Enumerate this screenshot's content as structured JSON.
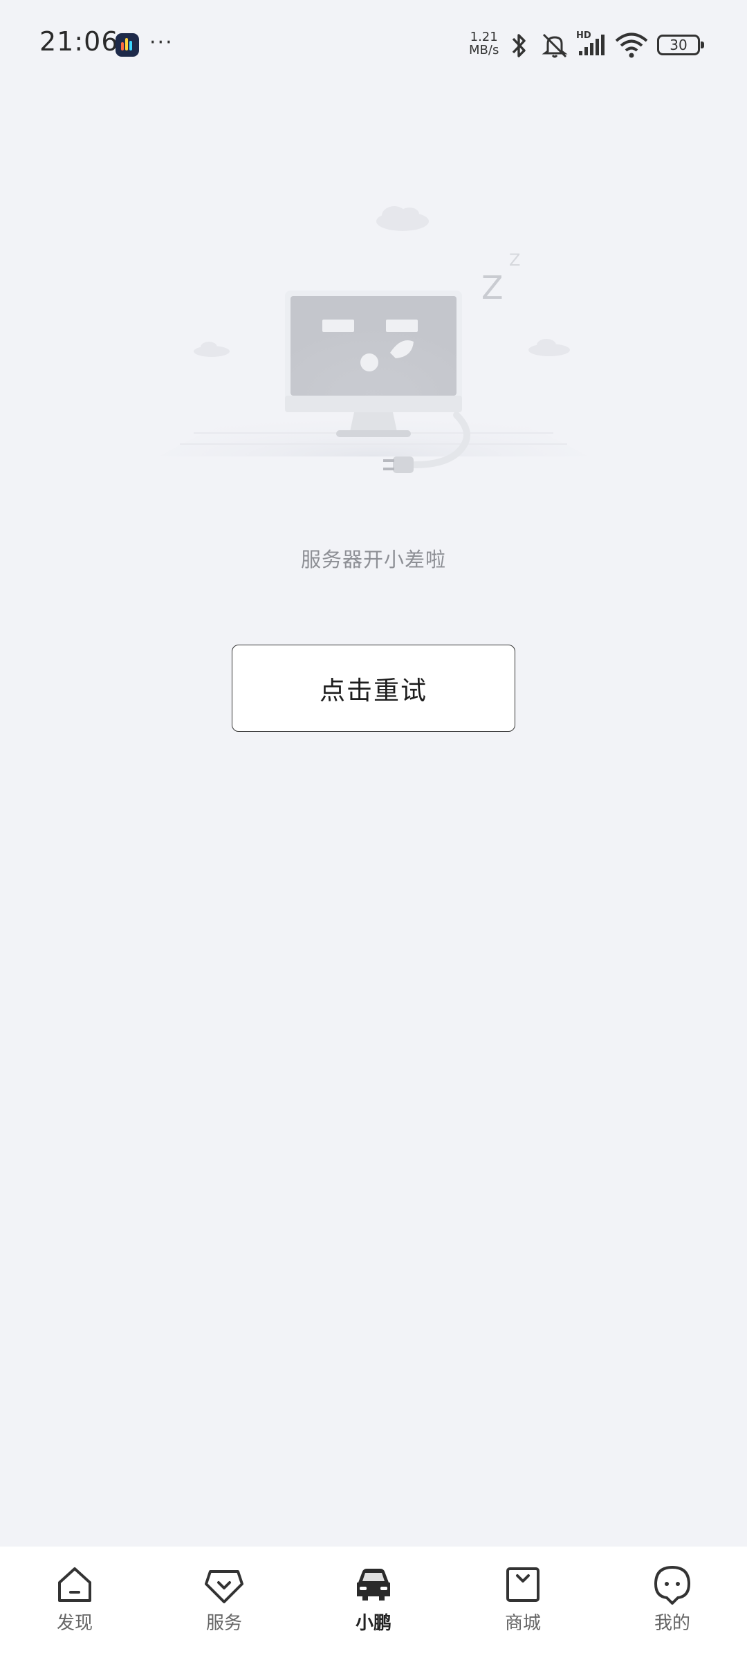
{
  "status_bar": {
    "time": "21:06",
    "app_icon": "app-notification-icon",
    "more": "···",
    "net_speed_value": "1.21",
    "net_speed_unit": "MB/s",
    "icons": [
      "bluetooth-icon",
      "mute-icon",
      "hd-signal-icon",
      "wifi-icon"
    ],
    "signal_label": "HD",
    "battery": "30"
  },
  "error_state": {
    "illustration": "server-down-monitor-illustration",
    "message": "服务器开小差啦",
    "retry_label": "点击重试"
  },
  "bottom_nav": {
    "active_index": 2,
    "items": [
      {
        "label": "发现",
        "icon": "home-icon"
      },
      {
        "label": "服务",
        "icon": "service-icon"
      },
      {
        "label": "小鹏",
        "icon": "car-icon"
      },
      {
        "label": "商城",
        "icon": "shopping-bag-icon"
      },
      {
        "label": "我的",
        "icon": "profile-icon"
      }
    ]
  }
}
